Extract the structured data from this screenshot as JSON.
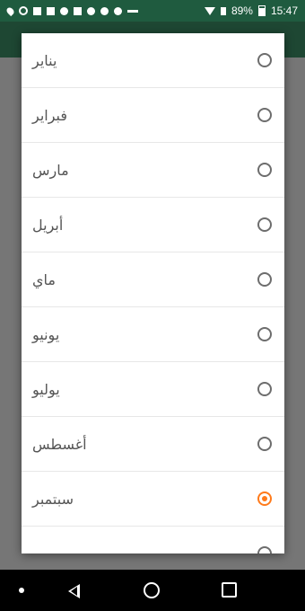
{
  "status_bar": {
    "battery": "89%",
    "time": "15:47"
  },
  "dialog": {
    "options": [
      {
        "label": "يناير",
        "selected": false
      },
      {
        "label": "فبراير",
        "selected": false
      },
      {
        "label": "مارس",
        "selected": false
      },
      {
        "label": "أبريل",
        "selected": false
      },
      {
        "label": "ماي",
        "selected": false
      },
      {
        "label": "يونيو",
        "selected": false
      },
      {
        "label": "يوليو",
        "selected": false
      },
      {
        "label": "أغسطس",
        "selected": false
      },
      {
        "label": "سبتمبر",
        "selected": true
      }
    ]
  },
  "colors": {
    "accent": "#ff7a1a",
    "status_bar": "#1f5b3f",
    "scrim": "#767676"
  },
  "icons": [
    "location-icon",
    "blocked-icon",
    "image-icon",
    "square-icon",
    "circle-icon",
    "calendar-icon",
    "music-icon",
    "chat-icon",
    "more-icon",
    "wifi-icon",
    "signal-icon",
    "battery-icon"
  ]
}
